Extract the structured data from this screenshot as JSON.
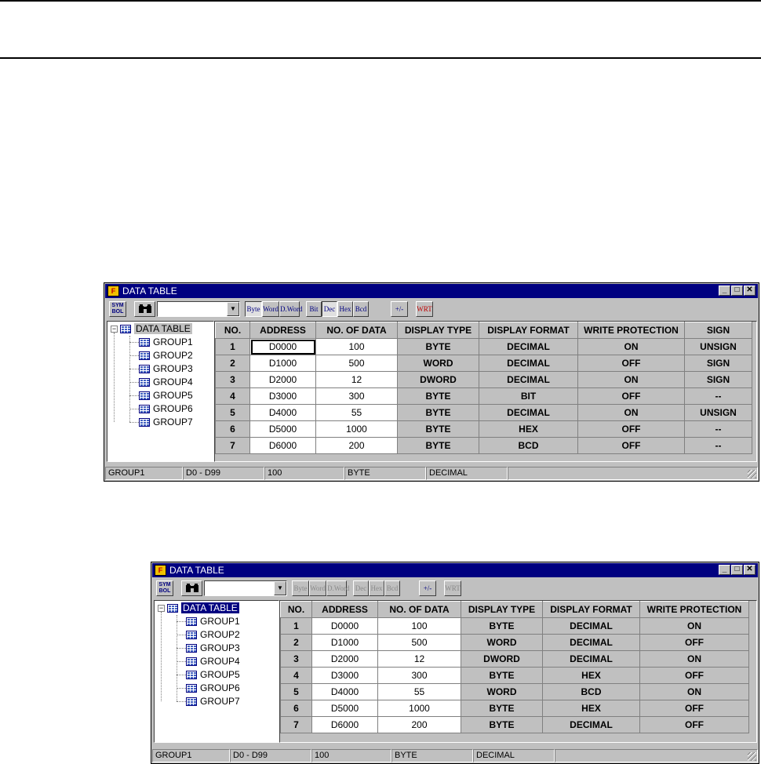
{
  "window1": {
    "title": "DATA TABLE",
    "toolbar": {
      "symbol_label": "SYM BOL",
      "search_value": "",
      "byte_label": "Byte",
      "word_label": "Word",
      "dword_label": "D.Word",
      "bit_label": "Bit",
      "dec_label": "Dec",
      "hex_label": "Hex",
      "bcd_label": "Bcd",
      "sign_label": "+/-",
      "write_label": "WRT"
    },
    "tree": {
      "root": "DATA TABLE",
      "groups": [
        "GROUP1",
        "GROUP2",
        "GROUP3",
        "GROUP4",
        "GROUP5",
        "GROUP6",
        "GROUP7"
      ]
    },
    "table": {
      "headers": [
        "NO.",
        "ADDRESS",
        "NO. OF DATA",
        "DISPLAY TYPE",
        "DISPLAY FORMAT",
        "WRITE PROTECTION",
        "SIGN"
      ],
      "rows": [
        [
          "1",
          "D0000",
          "100",
          "BYTE",
          "DECIMAL",
          "ON",
          "UNSIGN"
        ],
        [
          "2",
          "D1000",
          "500",
          "WORD",
          "DECIMAL",
          "OFF",
          "SIGN"
        ],
        [
          "3",
          "D2000",
          "12",
          "DWORD",
          "DECIMAL",
          "ON",
          "SIGN"
        ],
        [
          "4",
          "D3000",
          "300",
          "BYTE",
          "BIT",
          "OFF",
          "--"
        ],
        [
          "5",
          "D4000",
          "55",
          "BYTE",
          "DECIMAL",
          "ON",
          "UNSIGN"
        ],
        [
          "6",
          "D5000",
          "1000",
          "BYTE",
          "HEX",
          "OFF",
          "--"
        ],
        [
          "7",
          "D6000",
          "200",
          "BYTE",
          "BCD",
          "OFF",
          "--"
        ]
      ]
    },
    "status": [
      "GROUP1",
      "D0 - D99",
      "100",
      "BYTE",
      "DECIMAL"
    ]
  },
  "window2": {
    "title": "DATA TABLE",
    "toolbar": {
      "symbol_label": "SYM BOL",
      "search_value": "",
      "byte_label": "Byte",
      "word_label": "Word",
      "dword_label": "D.Word",
      "dec_label": "Dec",
      "hex_label": "Hex",
      "bcd_label": "Bcd",
      "sign_label": "+/-",
      "write_label": "WRT"
    },
    "tree": {
      "root": "DATA TABLE",
      "groups": [
        "GROUP1",
        "GROUP2",
        "GROUP3",
        "GROUP4",
        "GROUP5",
        "GROUP6",
        "GROUP7"
      ]
    },
    "table": {
      "headers": [
        "NO.",
        "ADDRESS",
        "NO. OF DATA",
        "DISPLAY TYPE",
        "DISPLAY FORMAT",
        "WRITE PROTECTION"
      ],
      "rows": [
        [
          "1",
          "D0000",
          "100",
          "BYTE",
          "DECIMAL",
          "ON"
        ],
        [
          "2",
          "D1000",
          "500",
          "WORD",
          "DECIMAL",
          "OFF"
        ],
        [
          "3",
          "D2000",
          "12",
          "DWORD",
          "DECIMAL",
          "ON"
        ],
        [
          "4",
          "D3000",
          "300",
          "BYTE",
          "HEX",
          "OFF"
        ],
        [
          "5",
          "D4000",
          "55",
          "WORD",
          "BCD",
          "ON"
        ],
        [
          "6",
          "D5000",
          "1000",
          "BYTE",
          "HEX",
          "OFF"
        ],
        [
          "7",
          "D6000",
          "200",
          "BYTE",
          "DECIMAL",
          "OFF"
        ]
      ]
    },
    "status": [
      "GROUP1",
      "D0 - D99",
      "100",
      "BYTE",
      "DECIMAL"
    ]
  },
  "icons": {
    "app": "app-icon",
    "binoculars": "binoculars-icon",
    "group": "table-group-icon"
  }
}
